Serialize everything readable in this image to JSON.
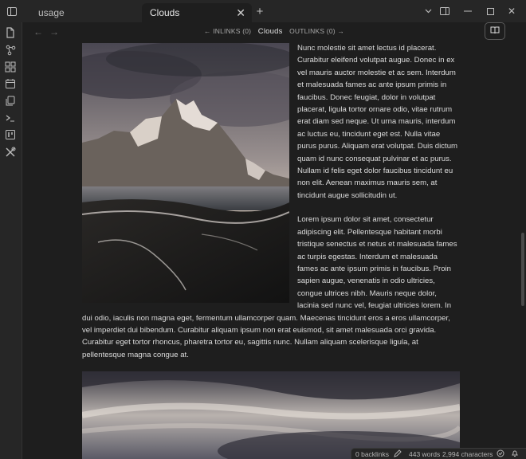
{
  "tabs": [
    {
      "label": "usage",
      "active": false
    },
    {
      "label": "Clouds",
      "active": true
    }
  ],
  "nav": {
    "inlinks": "← INLINKS (0)",
    "current": "Clouds",
    "outlinks": "OUTLINKS (0) →"
  },
  "content": {
    "paragraph1": "Nunc molestie sit amet lectus id placerat. Curabitur eleifend volutpat augue. Donec in ex vel mauris auctor molestie et ac sem. Interdum et malesuada fames ac ante ipsum primis in faucibus. Donec feugiat, dolor in volutpat placerat, ligula tortor ornare odio, vitae rutrum erat diam sed neque. Ut urna mauris, interdum ac luctus eu, tincidunt eget est. Nulla vitae purus purus. Aliquam erat volutpat. Duis dictum quam id nunc consequat pulvinar et ac purus. Nullam id felis eget dolor faucibus tincidunt eu non elit. Aenean maximus mauris sem, at tincidunt augue sollicitudin ut.",
    "paragraph2": "Lorem ipsum dolor sit amet, consectetur adipiscing elit. Pellentesque habitant morbi tristique senectus et netus et malesuada fames ac turpis egestas. Interdum et malesuada fames ac ante ipsum primis in faucibus. Proin sapien augue, venenatis in odio ultricies, congue ultrices nibh. Mauris neque dolor, lacinia sed nunc vel, feugiat ultricies lorem. In dui odio, iaculis non magna eget, fermentum ullamcorper quam. Maecenas tincidunt eros a eros ullamcorper, vel imperdiet dui bibendum. Curabitur aliquam ipsum non erat euismod, sit amet malesuada orci gravida. Curabitur eget tortor rhoncus, pharetra tortor eu, sagittis nunc. Nullam aliquam scelerisque ligula, at pellentesque magna congue at."
  },
  "status": {
    "backlinks": "0 backlinks",
    "words": "443 words",
    "characters": "2,994 characters"
  },
  "icons": [
    "sidebar-toggle-icon",
    "new-tab-icon",
    "chevron-down-icon",
    "split-view-icon",
    "minimize-icon",
    "maximize-icon",
    "close-icon",
    "files-icon",
    "graph-icon",
    "grid-icon",
    "calendar-icon",
    "copy-icon",
    "terminal-icon",
    "kanban-icon",
    "tools-icon",
    "back-arrow-icon",
    "forward-arrow-icon",
    "reading-view-icon",
    "edit-icon",
    "sync-icon",
    "bell-icon"
  ],
  "colors": {
    "background": "#1e1e1e",
    "chrome": "#262626",
    "text": "#dcdcdc"
  }
}
